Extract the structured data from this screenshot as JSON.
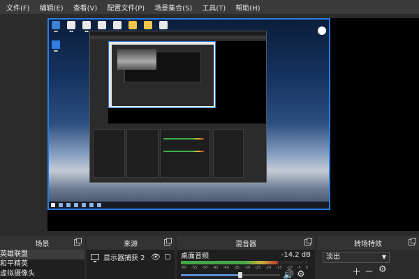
{
  "menu": [
    "文件(F)",
    "编辑(E)",
    "查看(V)",
    "配置文件(P)",
    "场景集合(S)",
    "工具(T)",
    "帮助(H)"
  ],
  "docks": {
    "scenes": {
      "title": "场景",
      "items": [
        "英雄联盟",
        "和平精英",
        "虚拟摄像头"
      ]
    },
    "sources": {
      "title": "来源",
      "item": "显示器捕获 2"
    },
    "mixer": {
      "title": "混音器",
      "channel": "桌面音频",
      "level": "-14.2 dB",
      "scale": [
        "-60",
        "-55",
        "-50",
        "-45",
        "-40",
        "-35",
        "-30",
        "-25",
        "-20",
        "-15",
        "-10",
        "-5",
        "0"
      ],
      "volume": 0.6
    },
    "transitions": {
      "title": "转场特效",
      "selected": "淡出"
    }
  },
  "icons": [
    "undock-icon",
    "monitor-icon",
    "eye-icon",
    "lock-icon",
    "speaker-icon",
    "gear-icon",
    "plus-icon",
    "minus-icon"
  ],
  "colors": {
    "selection": "#2a7de1",
    "meter_green": "#44a647",
    "meter_yellow": "#c8b23a",
    "meter_red": "#b53a30"
  }
}
